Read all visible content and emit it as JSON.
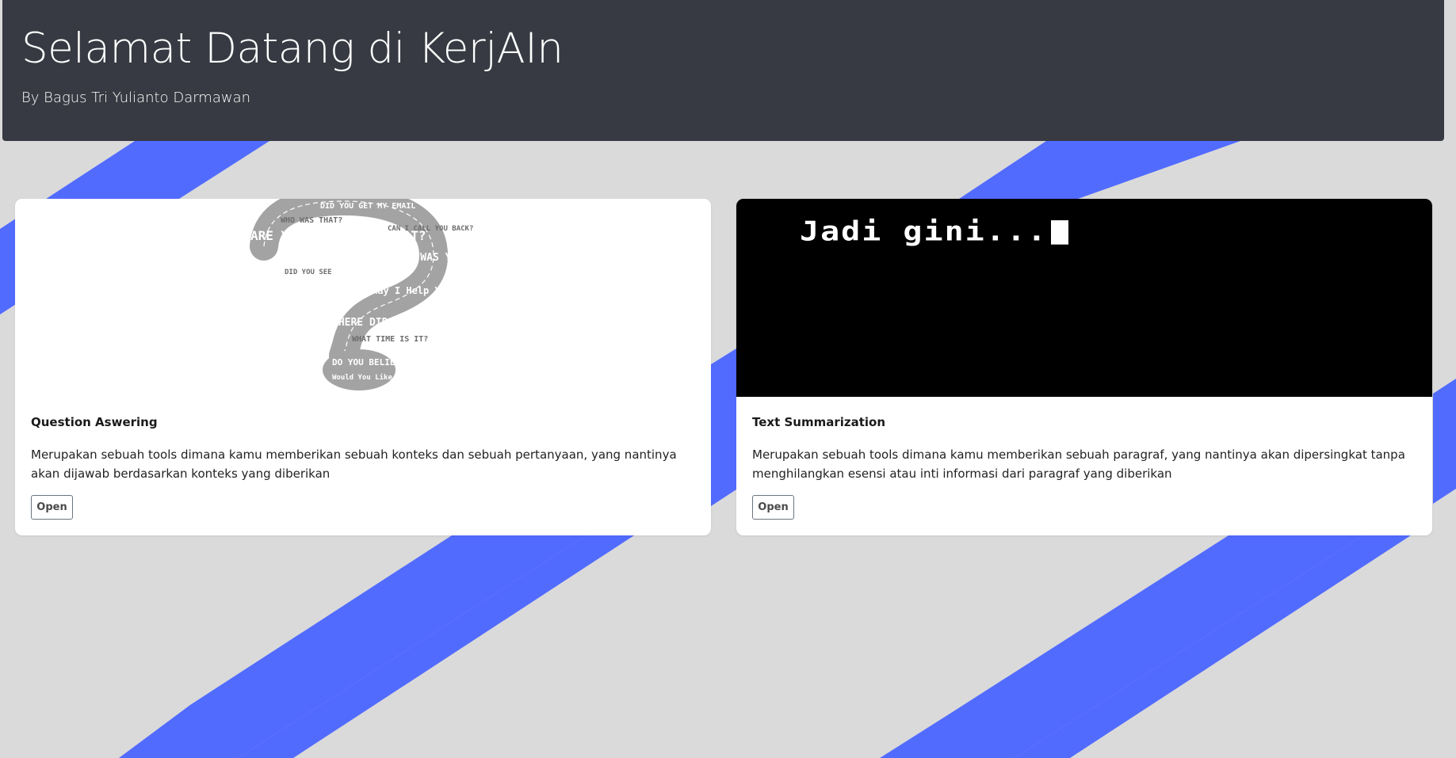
{
  "header": {
    "title": "Selamat Datang di KerjAIn",
    "subtitle": "By Bagus Tri Yulianto Darmawan"
  },
  "colors": {
    "header_bg": "#373a42",
    "page_bg": "#dadada",
    "stripe": "#526bff"
  },
  "cards": [
    {
      "title": "Question Aswering",
      "description": "Merupakan sebuah tools dimana kamu memberikan sebuah konteks dan sebuah pertanyaan, yang nantinya akan dijawab berdasarkan konteks yang diberikan",
      "button_label": "Open",
      "image_icon": "question-mark-word-cloud-icon",
      "image_words": [
        "DID YOU GET MY EMAIL",
        "ARE YOU GONNA EAT THAT?",
        "DID YOU SEE",
        "HOW WAS YOUR DAY?",
        "May I Help You?",
        "WHO WAS THAT?",
        "WHERE DID I PARK THE CAR?",
        "WHAT TIME IS IT?",
        "DO YOU BELIEVE IN GHOSTS?",
        "Would You Like Something To Drink?",
        "CAN I CALL YOU BACK?"
      ]
    },
    {
      "title": "Text Summarization",
      "description": "Merupakan sebuah tools dimana kamu memberikan sebuah paragraf, yang nantinya akan dipersingkat tanpa menghilangkan esensi atau inti informasi dari paragraf yang diberikan",
      "button_label": "Open",
      "image_text": "Jadi gini..."
    }
  ]
}
